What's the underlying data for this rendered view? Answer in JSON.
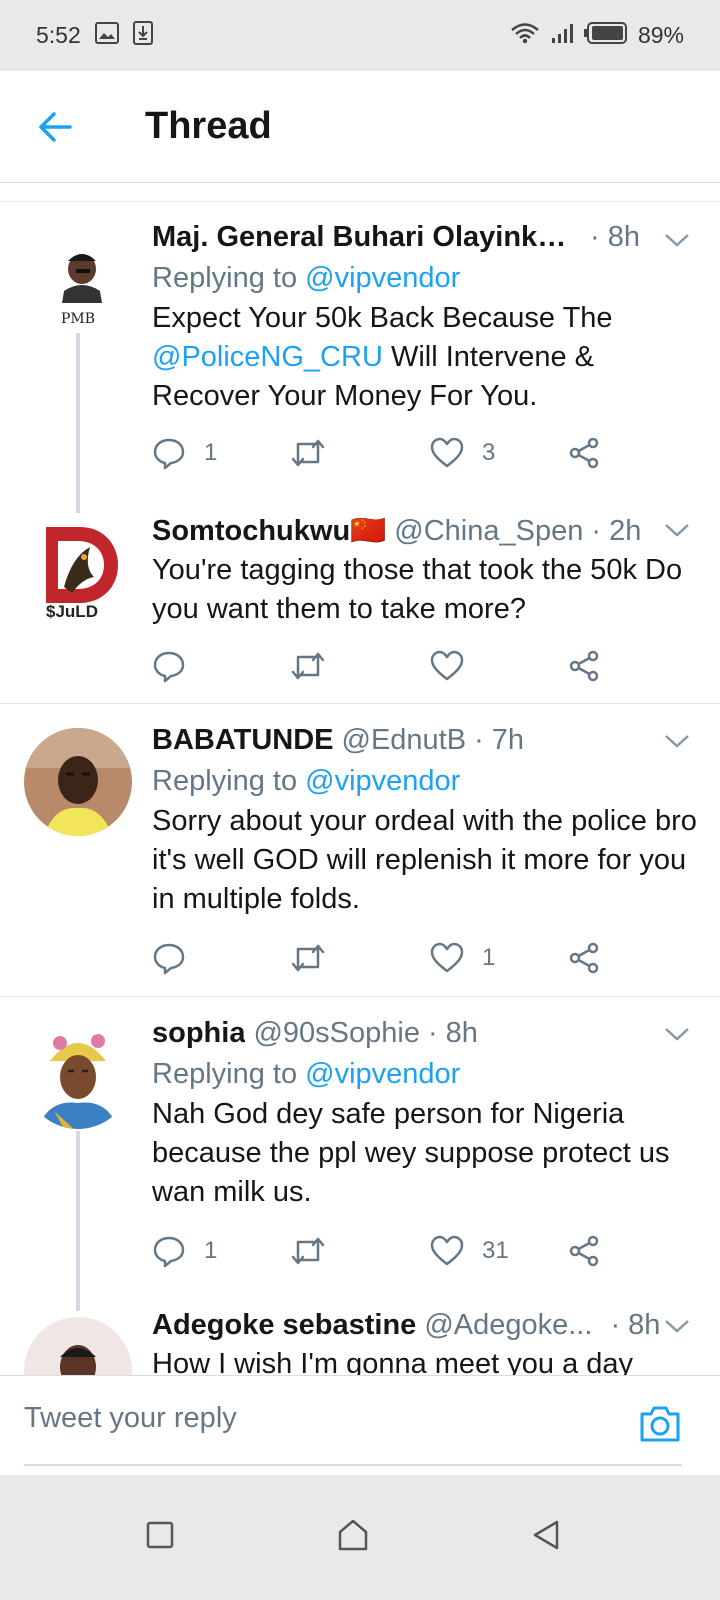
{
  "status_bar": {
    "time": "5:52",
    "battery": "89%"
  },
  "header": {
    "title": "Thread"
  },
  "tweets": [
    {
      "name": "Maj. General Buhari Olayinka (...",
      "handle": "",
      "time": "· 8h",
      "reply_prefix": "Replying to",
      "reply_to": "@vipvendor",
      "text_before": "Expect Your 50k Back Because The ",
      "mention": "@PoliceNG_CRU",
      "text_after": " Will Intervene & Recover Your Money For You.",
      "avatar_label": "PMB",
      "replies": "1",
      "retweets": "",
      "likes": "3"
    },
    {
      "name": "Somtochukwu🇨🇳",
      "handle": "@China_Spen",
      "time": "· 2h",
      "text": "You're tagging those that took the 50k Do you want them to take more?",
      "avatar_label": "$JuLD",
      "replies": "",
      "retweets": "",
      "likes": ""
    },
    {
      "name": "BABATUNDE",
      "handle": "@EdnutB",
      "time": "· 7h",
      "reply_prefix": "Replying to",
      "reply_to": "@vipvendor",
      "text": "Sorry about your ordeal with the police bro it's well GOD will replenish it more for you in multiple folds.",
      "replies": "",
      "retweets": "",
      "likes": "1"
    },
    {
      "name": "sophia",
      "handle": "@90sSophie",
      "time": "· 8h",
      "reply_prefix": "Replying to",
      "reply_to": "@vipvendor",
      "text": "Nah God dey safe person for Nigeria because the ppl wey suppose protect us wan milk us.",
      "replies": "1",
      "retweets": "",
      "likes": "31"
    },
    {
      "name": "Adegoke sebastine",
      "handle": "@Adegoke...",
      "time": "· 8h",
      "text": "How I wish I'm gonna meet you a day"
    }
  ],
  "composer": {
    "placeholder": "Tweet your reply"
  },
  "colors": {
    "accent": "#1da1f2",
    "secondary_text": "#657786",
    "divider": "#e1e8ed"
  },
  "icons": [
    "back-arrow-icon",
    "reply-icon",
    "retweet-icon",
    "like-icon",
    "share-icon",
    "caret-down-icon",
    "camera-icon",
    "recents-icon",
    "home-icon",
    "back-icon"
  ]
}
